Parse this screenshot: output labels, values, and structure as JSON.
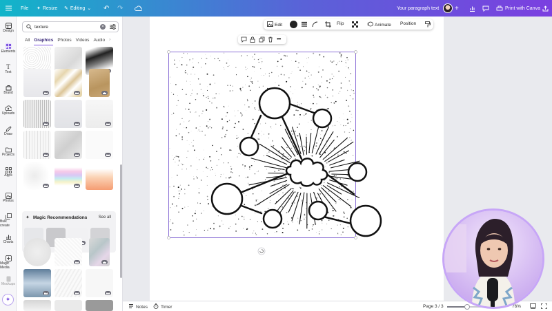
{
  "topbar": {
    "file_label": "File",
    "resize_label": "Resize",
    "mode_label": "Editing",
    "doc_title": "Your paragraph text",
    "print_label": "Print with Canva"
  },
  "rail": {
    "items": [
      {
        "label": "Design",
        "icon": "design-icon"
      },
      {
        "label": "Elements",
        "icon": "elements-icon"
      },
      {
        "label": "Text",
        "icon": "text-icon"
      },
      {
        "label": "Brand",
        "icon": "brand-icon"
      },
      {
        "label": "Uploads",
        "icon": "uploads-icon"
      },
      {
        "label": "Draw",
        "icon": "draw-icon"
      },
      {
        "label": "Projects",
        "icon": "projects-icon"
      },
      {
        "label": "Apps",
        "icon": "apps-icon"
      },
      {
        "label": "Photos",
        "icon": "photos-icon"
      },
      {
        "label": "Bulk create",
        "icon": "bulk-create-icon"
      },
      {
        "label": "Charts",
        "icon": "charts-icon"
      },
      {
        "label": "Magic Media",
        "icon": "magic-media-icon"
      },
      {
        "label": "Mockups",
        "icon": "mockups-icon"
      }
    ]
  },
  "panel": {
    "search_value": "texture",
    "tabs": [
      "All",
      "Graphics",
      "Photos",
      "Videos",
      "Audio"
    ],
    "active_tab": "Graphics",
    "magic_title": "Magic Recommendations",
    "see_all": "See all"
  },
  "float_toolbar": {
    "edit": "Edit",
    "flip": "Flip",
    "animate": "Animate",
    "position": "Position"
  },
  "bottombar": {
    "notes": "Notes",
    "timer": "Timer",
    "page_indicator": "Page 3 / 3",
    "zoom": "76%",
    "zoom_level": 0.76
  },
  "colors": {
    "accent": "#7a4fe0",
    "topbar_start": "#11b5c9",
    "topbar_end": "#7b3fe0",
    "selection": "#8b6fd6"
  }
}
